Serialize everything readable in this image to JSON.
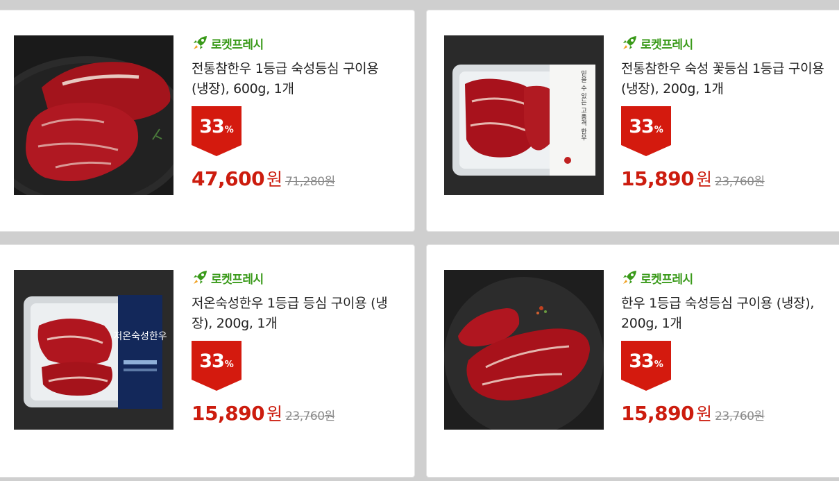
{
  "products": [
    {
      "badge": "로켓프레시",
      "title": "전통참한우 1등급 숙성등심 구이용 (냉장), 600g, 1개",
      "discount": "33",
      "discount_unit": "%",
      "price": "47,600",
      "currency": "원",
      "original_price": "71,280원",
      "image": "steak-on-dark-plate"
    },
    {
      "badge": "로켓프레시",
      "title": "전통참한우 숙성 꽃등심 1등급 구이용 (냉장), 200g, 1개",
      "discount": "33",
      "discount_unit": "%",
      "price": "15,890",
      "currency": "원",
      "original_price": "23,760원",
      "image": "packaged-steak-tray",
      "package_text": "믿을 수 있는 고품격 한우"
    },
    {
      "badge": "로켓프레시",
      "title": "저온숙성한우 1등급 등심 구이용 (냉장), 200g, 1개",
      "discount": "33",
      "discount_unit": "%",
      "price": "15,890",
      "currency": "원",
      "original_price": "23,760원",
      "image": "packaged-steak-blue-label",
      "package_text": "저온숙성한우"
    },
    {
      "badge": "로켓프레시",
      "title": "한우 1등급 숙성등심 구이용 (냉장), 200g, 1개",
      "discount": "33",
      "discount_unit": "%",
      "price": "15,890",
      "currency": "원",
      "original_price": "23,760원",
      "image": "steak-on-slate"
    }
  ],
  "colors": {
    "badge_green": "#3a9a1a",
    "price_red": "#cc1c0e",
    "discount_red": "#d41a0e"
  }
}
